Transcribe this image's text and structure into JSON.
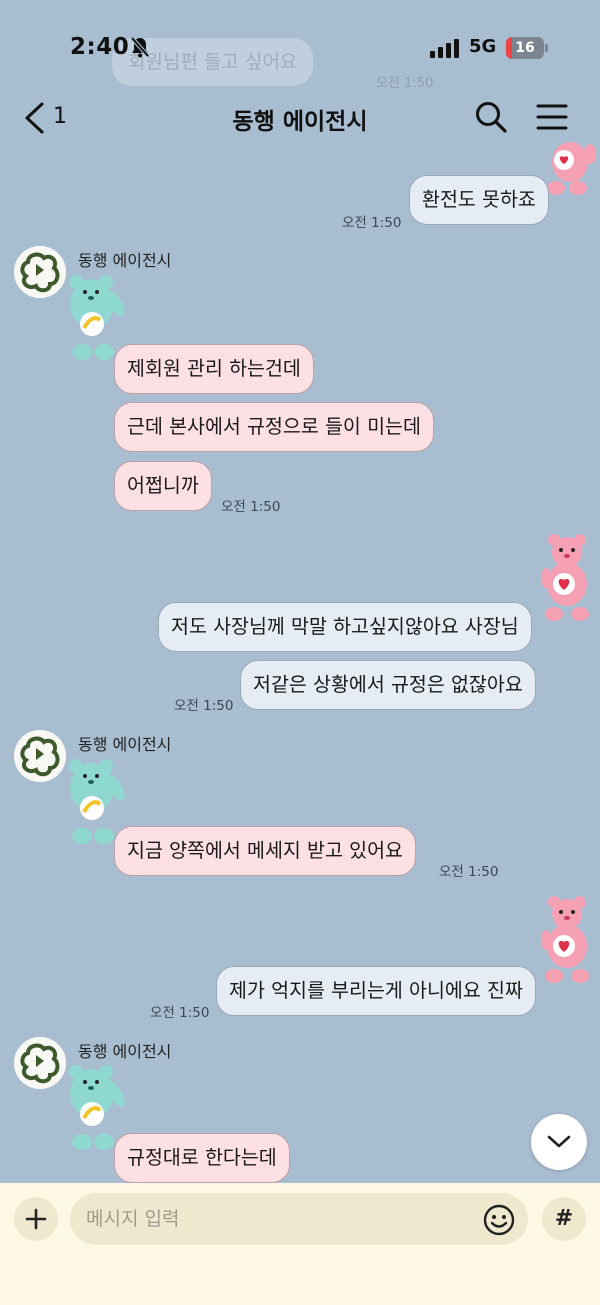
{
  "status_bar": {
    "time": "2:40",
    "network": "5G",
    "battery": "16",
    "battery_fraction": 0.16
  },
  "background_preview": {
    "text": "회원님편 들고 싶어요",
    "time": "오전 1:50"
  },
  "header": {
    "unread_count": "1",
    "title": "동행 에이전시"
  },
  "messages": {
    "m0": {
      "text": "환전도 못하죠",
      "time": "오전 1:50"
    },
    "g1": {
      "sender": "동행 에이전시",
      "b1": "제회원 관리 하는건데",
      "b2": "근데 본사에서 규정으로 들이 미는데",
      "b3": "어쩝니까",
      "time": "오전 1:50"
    },
    "g2": {
      "b1": "저도 사장님께 막말 하고싶지않아요 사장님",
      "b2": "저같은 상황에서 규정은 없잖아요",
      "time": "오전 1:50"
    },
    "g3": {
      "sender": "동행 에이전시",
      "b1": "지금 양쪽에서 메세지 받고 있어요",
      "time": "오전 1:50"
    },
    "g4": {
      "b1": "제가 억지를 부리는게 아니에요 진짜",
      "time": "오전 1:50"
    },
    "g5": {
      "sender": "동행 에이전시",
      "b1": "규정대로 한다는데"
    }
  },
  "input_bar": {
    "placeholder": "메시지 입력",
    "hash_label": "#"
  },
  "icons": {
    "back": "chevron-left-icon",
    "search": "search-icon",
    "menu": "hamburger-menu-icon",
    "mute": "bell-slash-icon",
    "emoji": "smiley-icon",
    "plus": "plus-icon",
    "scroll": "chevron-down-icon"
  },
  "colors": {
    "background": "#a9bdd0",
    "incoming_bubble": "#fde0e4",
    "outgoing_bubble": "#e6ecf3",
    "input_bar": "#fdf8e4",
    "battery_low": "#f04343"
  }
}
